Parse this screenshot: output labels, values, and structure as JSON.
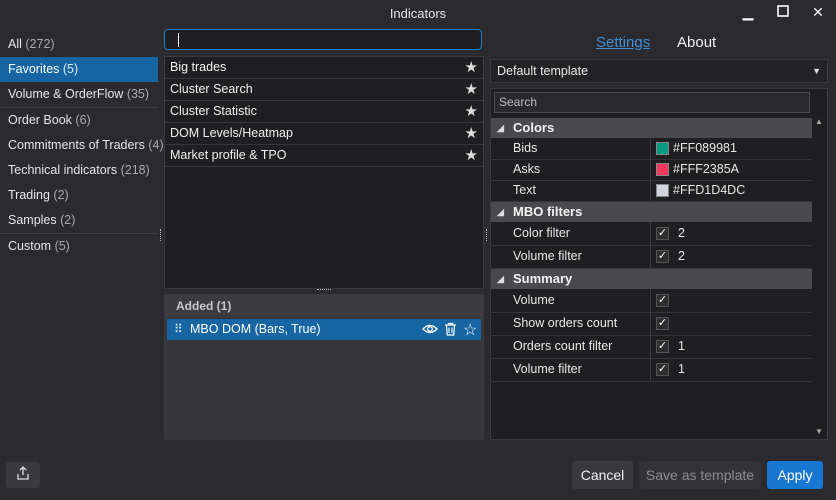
{
  "window": {
    "title": "Indicators",
    "controls": [
      "minimize-icon",
      "maximize-icon",
      "close-icon"
    ]
  },
  "categories": [
    {
      "label": "All",
      "count": "(272)"
    },
    {
      "label": "Favorites",
      "count": "(5)"
    },
    {
      "label": "Volume & OrderFlow",
      "count": "(35)"
    },
    {
      "label": "Order Book",
      "count": "(6)"
    },
    {
      "label": "Commitments of Traders",
      "count": "(4)"
    },
    {
      "label": "Technical indicators",
      "count": "(218)"
    },
    {
      "label": "Trading",
      "count": "(2)"
    },
    {
      "label": "Samples",
      "count": "(2)"
    },
    {
      "label": "Custom",
      "count": "(5)"
    }
  ],
  "selected_category": "Favorites",
  "search": {
    "value": "",
    "placeholder": ""
  },
  "indicators": [
    "Big trades",
    "Cluster Search",
    "Cluster Statistic",
    "DOM Levels/Heatmap",
    "Market profile & TPO"
  ],
  "added": {
    "header": "Added (1)",
    "items": [
      {
        "label": "MBO DOM (Bars, True)"
      }
    ]
  },
  "tabs": {
    "settings": "Settings",
    "about": "About"
  },
  "template": {
    "value": "Default template"
  },
  "prop_search": {
    "placeholder": "Search"
  },
  "groups": {
    "colors": {
      "label": "Colors",
      "rows": [
        {
          "label": "Bids",
          "value": "#FF089981",
          "color": "#089981"
        },
        {
          "label": "Asks",
          "value": "#FFF2385A",
          "color": "#F2385A"
        },
        {
          "label": "Text",
          "value": "#FFD1D4DC",
          "color": "#D1D4DC"
        }
      ]
    },
    "mbo": {
      "label": "MBO filters",
      "rows": [
        {
          "label": "Color filter",
          "checked": true,
          "value": "2"
        },
        {
          "label": "Volume filter",
          "checked": true,
          "value": "2"
        }
      ]
    },
    "summary": {
      "label": "Summary",
      "rows": [
        {
          "label": "Volume",
          "checked": true,
          "value": ""
        },
        {
          "label": "Show orders count",
          "checked": true,
          "value": ""
        },
        {
          "label": "Orders count filter",
          "checked": true,
          "value": "1"
        },
        {
          "label": "Volume filter",
          "checked": true,
          "value": "1"
        }
      ]
    }
  },
  "buttons": {
    "cancel": "Cancel",
    "save_template": "Save as template",
    "apply": "Apply"
  },
  "colors": {
    "accent": "#1765a3",
    "apply": "#1877d2",
    "link": "#3d8fd6"
  }
}
